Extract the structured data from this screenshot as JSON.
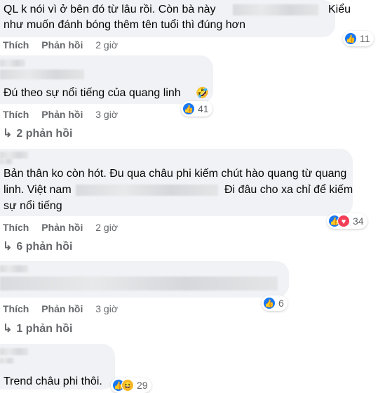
{
  "comments": [
    {
      "text_lines": [
        "QL k nói vì ở bên đó từ lâu rồi. Còn bà này",
        "như muốn đánh bóng thêm tên tuổi thì đúng hơn"
      ],
      "text_after_blur": "Kiểu",
      "actions": {
        "like": "Thích",
        "reply": "Phản hồi",
        "time": "2 giờ"
      },
      "reactions": {
        "icons": [
          "like-icon"
        ],
        "count": "11"
      }
    },
    {
      "text": "Đú theo sự nổi tiếng của quang linh",
      "emoji": "🤣",
      "actions": {
        "like": "Thích",
        "reply": "Phản hồi",
        "time": "3 giờ"
      },
      "reactions": {
        "icons": [
          "like-icon"
        ],
        "count": "41"
      },
      "replies": "2 phản hồi"
    },
    {
      "text_lines": [
        "Bản thân ko còn hót. Đu qua châu phi kiếm chút hào quang từ quang",
        "linh. Việt nam",
        "sự nổi tiếng"
      ],
      "text_after_blur": "Đi đâu cho xa chỉ để kiếm",
      "actions": {
        "like": "Thích",
        "reply": "Phản hồi",
        "time": "2 giờ"
      },
      "reactions": {
        "icons": [
          "like-icon",
          "heart-icon"
        ],
        "count": "34"
      },
      "replies": "6 phản hồi"
    },
    {
      "actions": {
        "like": "Thích",
        "reply": "Phản hồi",
        "time": "3 giờ"
      },
      "reactions": {
        "icons": [
          "like-icon"
        ],
        "count": "6"
      },
      "replies": "1 phản hồi"
    },
    {
      "text": "Trend châu phi thôi.",
      "reactions": {
        "icons": [
          "like-icon",
          "haha-icon"
        ],
        "count": "29"
      }
    }
  ],
  "colors": {
    "bubble": "#f0f2f5",
    "meta": "#65676b",
    "like": "#1877f2",
    "heart": "#f33e58",
    "haha": "#f7b928"
  }
}
